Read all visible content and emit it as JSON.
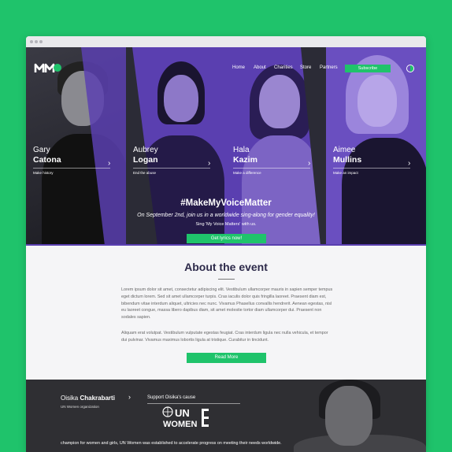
{
  "nav": {
    "items": [
      "Home",
      "About",
      "Charities",
      "Store",
      "Partners"
    ],
    "subscribe_label": "Subscribe"
  },
  "hero": {
    "people": [
      {
        "first": "Gary",
        "last": "Catona",
        "tagline": "Make history"
      },
      {
        "first": "Aubrey",
        "last": "Logan",
        "tagline": "End the abuse"
      },
      {
        "first": "Hala",
        "last": "Kazim",
        "tagline": "Make a difference"
      },
      {
        "first": "Aimee",
        "last": "Mullins",
        "tagline": "Make an impact"
      }
    ],
    "hashtag": "#MakeMyVoiceMatter",
    "tagline": "On September 2nd, join us in a worldwide sing-along for gender equality!",
    "sing_line": "Sing 'My Voice Matters' with us.",
    "cta_label": "Get lyrics now!"
  },
  "about": {
    "title": "About the event",
    "paragraph1": "Lorem ipsum dolor sit amet, consectetur adipiscing elit. Vestibulum ullamcorper mauris in sapien semper tempus eget dictum lorem. Sed sit amet ullamcorper turpis. Cras iaculis dolor quis fringilla laoreet. Praesent diam est, bibendum vitae interdum aliquet, ultricies nec nunc. Vivamus Phasellus convallis hendrerit. Aenean egestas, nisl eu laoreet congue, massa libero dapibus diam, sit amet molestie tortor diam ullamcorper dui. Praesent non sodales sapien.",
    "paragraph2": "Aliquam erat volutpat. Vestibulum vulputate egestas feugiat. Cras interdum ligula nec nulla vehicula, et tempor dui pulvinar. Vivamus maximus lobortis ligula at tristique. Curabitur in tincidunt.",
    "read_more_label": "Read More"
  },
  "champion": {
    "first": "Oisika",
    "last": "Chakrabarti",
    "org": "UN Women organization",
    "support_label": "Support Oisika's cause",
    "logo_top": "UN",
    "logo_bottom": "WOMEN",
    "text": "champion for women and girls, UN Women was established to accelerate progress on meeting their needs worldwide."
  },
  "colors": {
    "brand_green": "#1fc36b",
    "hero_purple": "#5a3fb0",
    "heading_navy": "#2d2a4a"
  },
  "icons": [
    "mmvm-logo",
    "language-toggle-icon",
    "chevron-right-icon",
    "un-women-logo"
  ]
}
